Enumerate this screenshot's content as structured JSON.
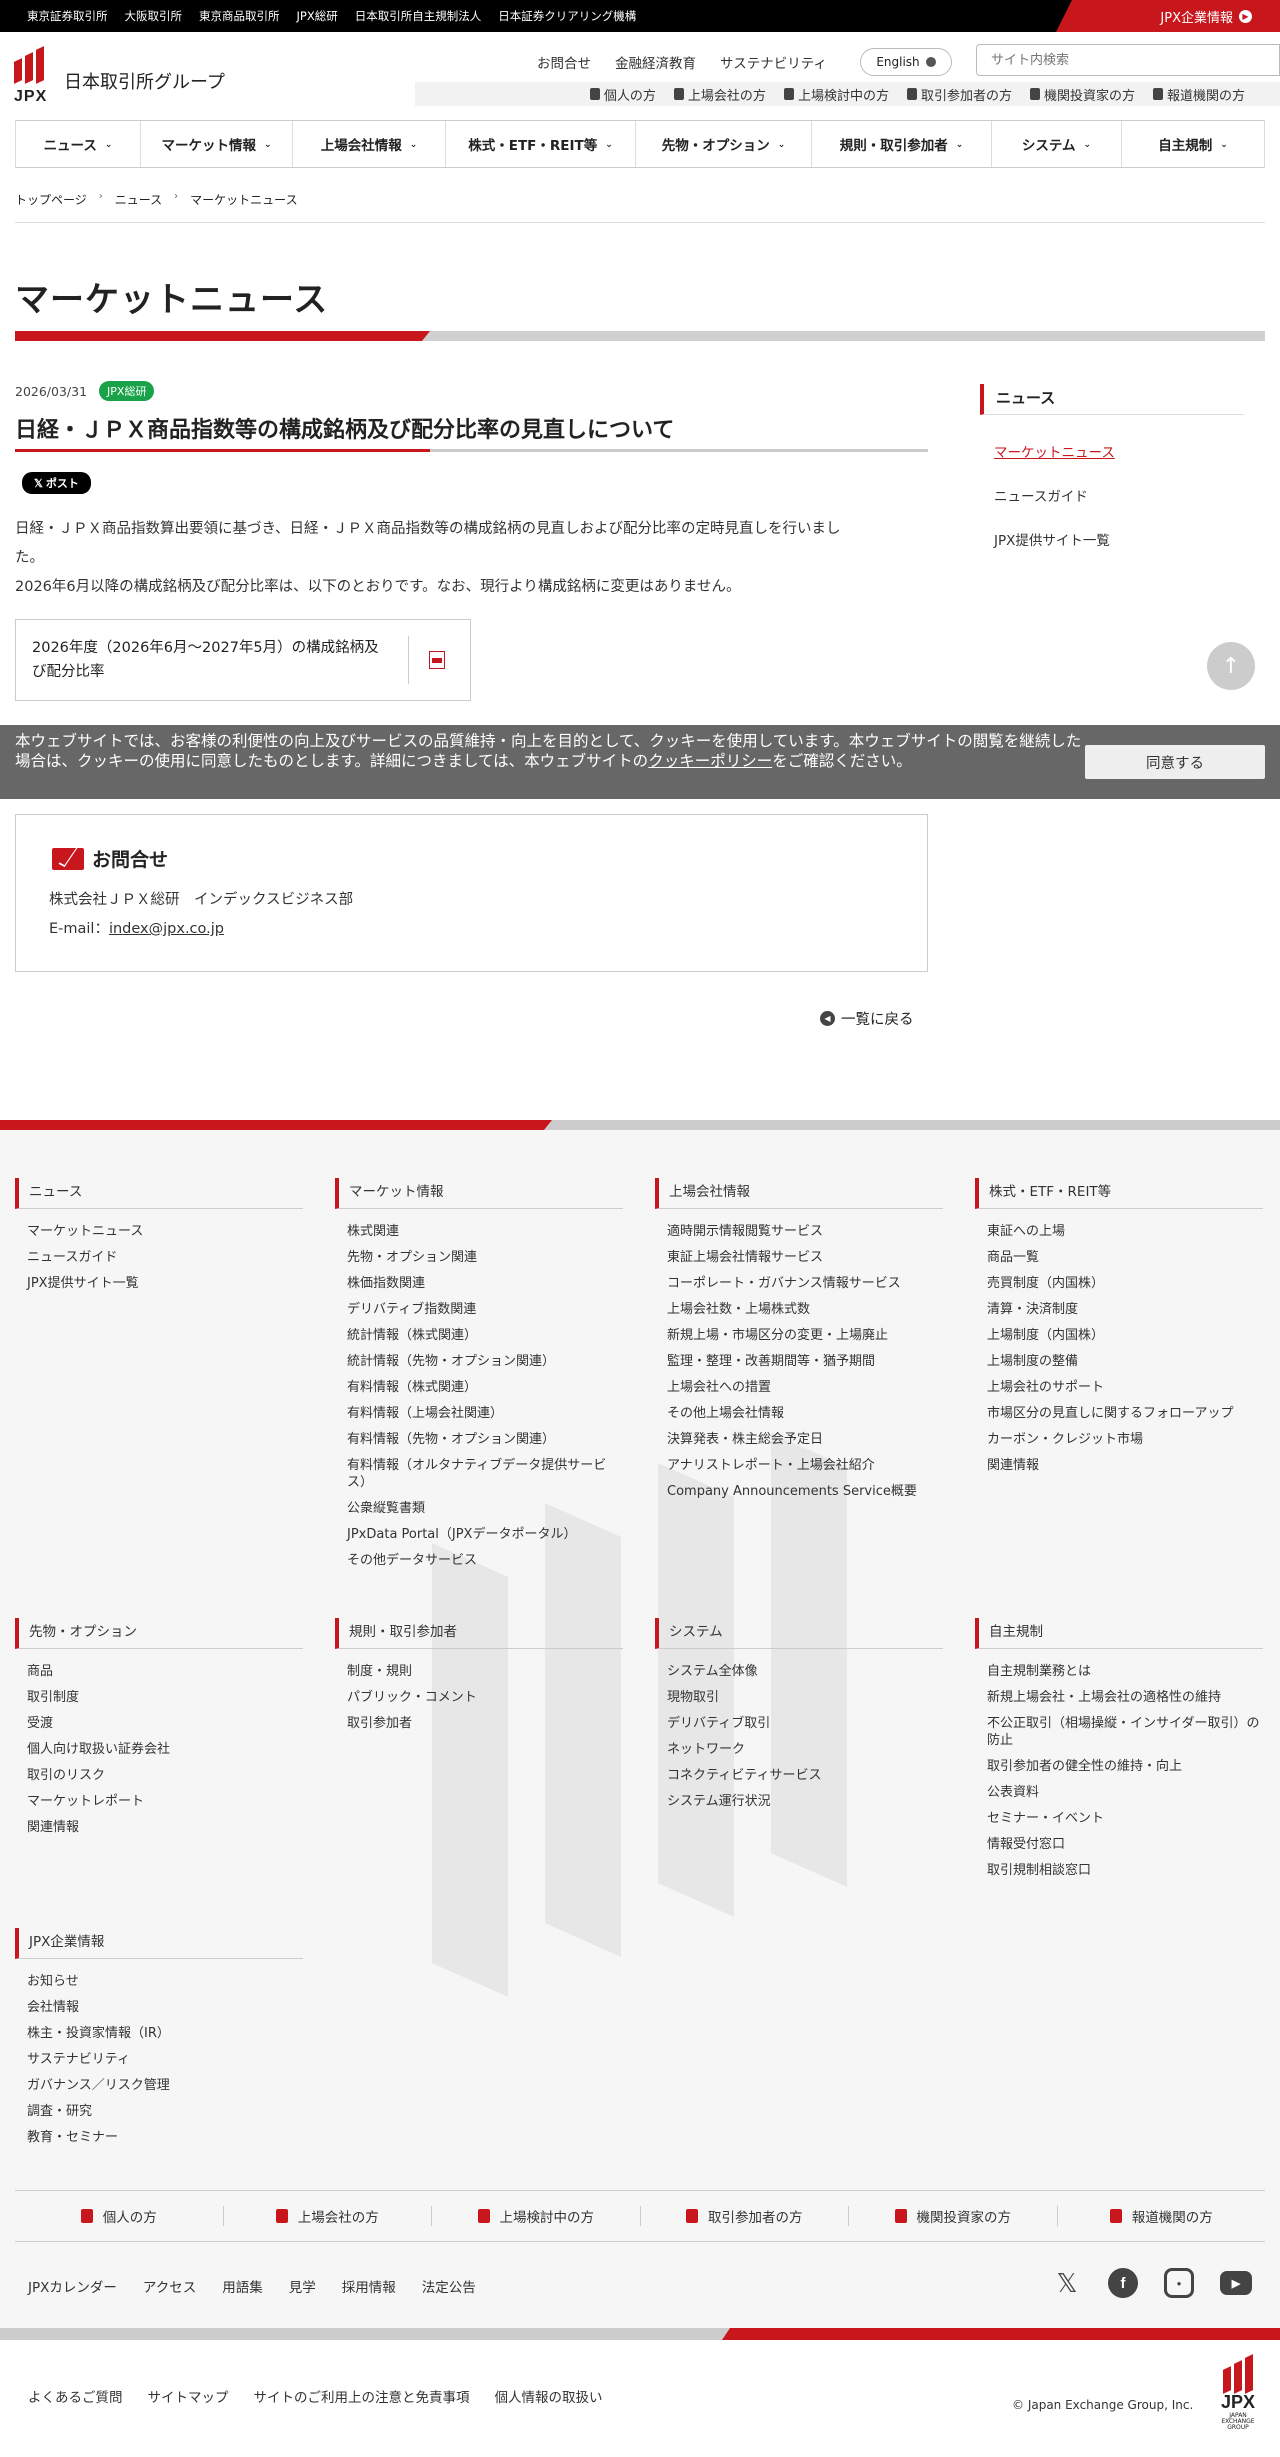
{
  "topbar": {
    "links": [
      "東京証券取引所",
      "大阪取引所",
      "東京商品取引所",
      "JPX総研",
      "日本取引所自主規制法人",
      "日本証券クリアリング機構"
    ],
    "corporate": "JPX企業情報"
  },
  "header": {
    "logo_word": "JPX",
    "logo_text": "日本取引所グループ",
    "util_links": [
      "お問合せ",
      "金融経済教育",
      "サステナビリティ"
    ],
    "lang": "English",
    "search_placeholder": "サイト内検索",
    "audiences": [
      "個人の方",
      "上場会社の方",
      "上場検討中の方",
      "取引参加者の方",
      "機関投資家の方",
      "報道機関の方"
    ]
  },
  "gnav": [
    {
      "label": "ニュース",
      "w": 126
    },
    {
      "label": "マーケット情報",
      "w": 152
    },
    {
      "label": "上場会社情報",
      "w": 153
    },
    {
      "label": "株式・ETF・REIT等",
      "w": 190
    },
    {
      "label": "先物・オプション",
      "w": 176
    },
    {
      "label": "規則・取引参加者",
      "w": 180
    },
    {
      "label": "システム",
      "w": 130
    },
    {
      "label": "自主規制",
      "w": 143
    }
  ],
  "breadcrumb": [
    "トップページ",
    "ニュース",
    "マーケットニュース"
  ],
  "page_title": "マーケットニュース",
  "article": {
    "date": "2026/03/31",
    "tag": "JPX総研",
    "tag_color": "#1aa24a",
    "title": "日経・ＪＰＸ商品指数等の構成銘柄及び配分比率の見直しについて",
    "x_post": "𝕏 ポスト",
    "body_lines": [
      "日経・ＪＰＸ商品指数算出要領に基づき、日経・ＪＰＸ商品指数等の構成銘柄の見直しおよび配分比率の定時見直しを行いまし",
      "た。",
      "2026年6月以降の構成銘柄及び配分比率は、以下のとおりです。なお、現行より構成銘柄に変更はありません。"
    ],
    "file_label": "2026年度（2026年6月～2027年5月）の構成銘柄及び配分比率",
    "file_icon": "pdf-icon"
  },
  "side": {
    "heading": "ニュース",
    "links": [
      "マーケットニュース",
      "ニュースガイド",
      "JPX提供サイト一覧"
    ]
  },
  "cookie": {
    "text_pre": "本ウェブサイトでは、お客様の利便性の向上及びサービスの品質維持・向上を目的として、クッキーを使用しています。本ウェブサイトの閲覧を継続した場合は、クッキーの使用に同意したものとします。詳細につきましては、本ウェブサイトの",
    "link": "クッキーポリシー",
    "text_post": "をご確認ください。",
    "agree": "同意する"
  },
  "contact": {
    "heading": "お問合せ",
    "org": "株式会社ＪＰＸ総研　インデックスビジネス部",
    "email_label": "E-mail：",
    "email": "index@jpx.co.jp"
  },
  "back": "一覧に戻る",
  "footer": {
    "columns": [
      {
        "heading": "ニュース",
        "items": [
          "マーケットニュース",
          "ニュースガイド",
          "JPX提供サイト一覧"
        ]
      },
      {
        "heading": "マーケット情報",
        "items": [
          "株式関連",
          "先物・オプション関連",
          "株価指数関連",
          "デリバティブ指数関連",
          "統計情報（株式関連）",
          "統計情報（先物・オプション関連）",
          "有料情報（株式関連）",
          "有料情報（上場会社関連）",
          "有料情報（先物・オプション関連）",
          "有料情報（オルタナティブデータ提供サービス）",
          "公衆縦覧書類",
          "JPxData Portal（JPXデータポータル）",
          "その他データサービス"
        ]
      },
      {
        "heading": "上場会社情報",
        "items": [
          "適時開示情報閲覧サービス",
          "東証上場会社情報サービス",
          "コーポレート・ガバナンス情報サービス",
          "上場会社数・上場株式数",
          "新規上場・市場区分の変更・上場廃止",
          "監理・整理・改善期間等・猶予期間",
          "上場会社への措置",
          "その他上場会社情報",
          "決算発表・株主総会予定日",
          "アナリストレポート・上場会社紹介",
          "Company Announcements Service概要"
        ]
      },
      {
        "heading": "株式・ETF・REIT等",
        "items": [
          "東証への上場",
          "商品一覧",
          "売買制度（内国株）",
          "清算・決済制度",
          "上場制度（内国株）",
          "上場制度の整備",
          "上場会社のサポート",
          "市場区分の見直しに関するフォローアップ",
          "カーボン・クレジット市場",
          "関連情報"
        ]
      },
      {
        "heading": "先物・オプション",
        "items": [
          "商品",
          "取引制度",
          "受渡",
          "個人向け取扱い証券会社",
          "取引のリスク",
          "マーケットレポート",
          "関連情報"
        ]
      },
      {
        "heading": "規則・取引参加者",
        "items": [
          "制度・規則",
          "パブリック・コメント",
          "取引参加者"
        ]
      },
      {
        "heading": "システム",
        "items": [
          "システム全体像",
          "現物取引",
          "デリバティブ取引",
          "ネットワーク",
          "コネクティビティサービス",
          "システム運行状況"
        ]
      },
      {
        "heading": "自主規制",
        "items": [
          "自主規制業務とは",
          "新規上場会社・上場会社の適格性の維持",
          "不公正取引（相場操縦・インサイダー取引）の防止",
          "取引参加者の健全性の維持・向上",
          "公表資料",
          "セミナー・イベント",
          "情報受付窓口",
          "取引規制相談窓口"
        ]
      },
      {
        "heading": "JPX企業情報",
        "items": [
          "お知らせ",
          "会社情報",
          "株主・投資家情報（IR）",
          "サステナビリティ",
          "ガバナンス／リスク管理",
          "調査・研究",
          "教育・セミナー"
        ]
      }
    ],
    "audiences": [
      "個人の方",
      "上場会社の方",
      "上場検討中の方",
      "取引参加者の方",
      "機関投資家の方",
      "報道機関の方"
    ],
    "bottom_links": [
      "JPXカレンダー",
      "アクセス",
      "用語集",
      "見学",
      "採用情報",
      "法定公告"
    ],
    "social": [
      "x-icon",
      "facebook-icon",
      "instagram-icon",
      "youtube-icon"
    ],
    "legal_links": [
      "よくあるご質問",
      "サイトマップ",
      "サイトのご利用上の注意と免責事項",
      "個人情報の取扱い"
    ],
    "copyright": "© Japan Exchange Group, Inc.",
    "logo_word": "JPX",
    "logo_small": "JAPAN EXCHANGE GROUP",
    "accent": "#c8161d"
  }
}
